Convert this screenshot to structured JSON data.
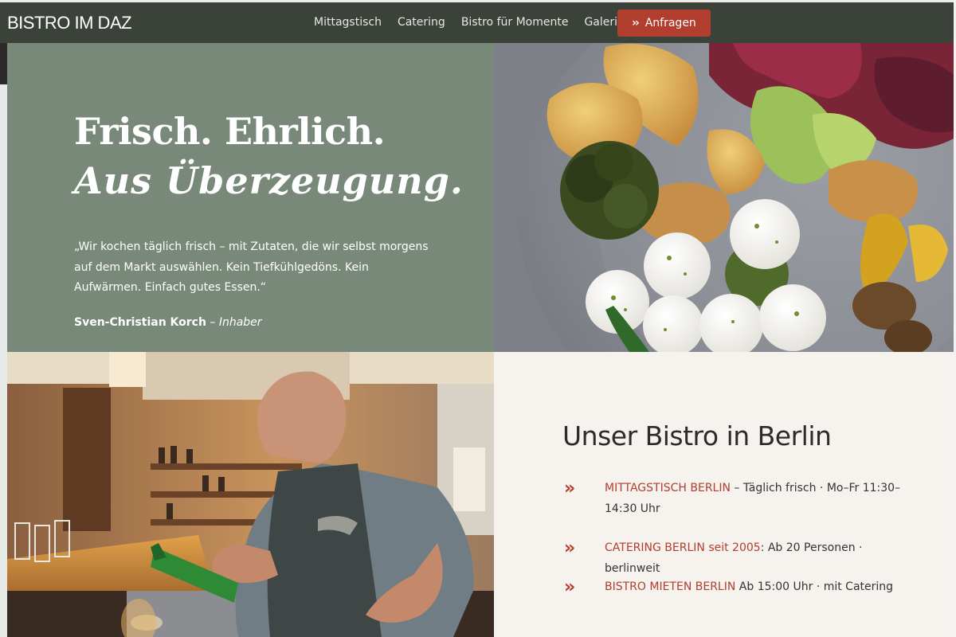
{
  "nav": {
    "logo": "BISTRO IM DAZ",
    "links": [
      "Mittagstisch",
      "Catering",
      "Bistro für Momente",
      "Galerie"
    ],
    "cta_label": "Anfragen"
  },
  "hero": {
    "headline_line1": "Frisch. Ehrlich.",
    "headline_line2": "Aus Überzeugung.",
    "quote": "„Wir kochen täglich frisch – mit Zutaten, die wir selbst morgens auf dem Markt auswählen. Kein Tiefkühlgedöns. Kein Aufwärmen. Einfach gutes Essen.“",
    "author_name": "Sven-Christian Korch",
    "author_sep": " – ",
    "author_role": "Inhaber"
  },
  "info": {
    "title": "Unser Bistro in Berlin",
    "items": [
      {
        "highlight": "MITTAGSTISCH BERLIN",
        "text": " – Täglich frisch · Mo–Fr 11:30–14:30 Uhr"
      },
      {
        "highlight": "CATERING BERLIN seit 2005",
        "text": ": Ab 20 Personen · berlinweit"
      },
      {
        "highlight": "BISTRO MIETEN BERLIN",
        "text": " Ab 15:00 Uhr · mit Catering"
      }
    ]
  },
  "colors": {
    "nav_bg": "#3b4239",
    "hero_bg": "#78897a",
    "accent": "#b13e2e",
    "info_bg": "#f6f2ee"
  },
  "icons": [
    "double-chevron-right-icon"
  ]
}
